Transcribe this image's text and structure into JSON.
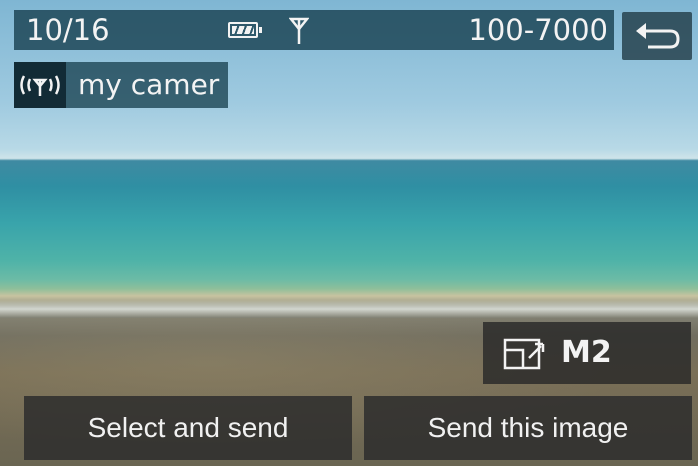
{
  "status_bar": {
    "frame_counter": "10/16",
    "folder_number": "100-7000",
    "battery_icon": "battery-full-icon",
    "antenna_icon": "antenna-icon"
  },
  "back_button": {
    "icon": "return-arrow-icon"
  },
  "wifi_target": {
    "icon": "wireless-signal-icon",
    "name": "my camer"
  },
  "image_size": {
    "icon": "image-size-icon",
    "value": "M2"
  },
  "actions": {
    "select_and_send": "Select and send",
    "send_this_image": "Send this image"
  },
  "colors": {
    "overlay_bar": "#143c4b",
    "button_bg": "#2d2d2d",
    "text": "#f3f3f3"
  }
}
